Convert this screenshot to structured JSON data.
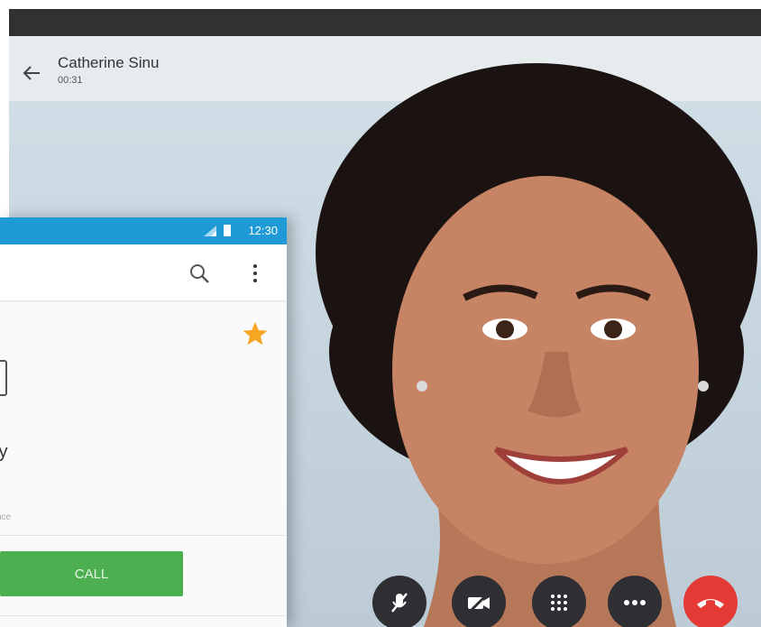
{
  "call": {
    "contact_name": "Catherine Sinu",
    "timer": "00:31",
    "controls": {
      "mute_icon": "mic-off-icon",
      "video_icon": "video-off-icon",
      "keypad_icon": "dialpad-icon",
      "more_icon": "more-horizontal-icon",
      "end_icon": "end-call-icon"
    },
    "colors": {
      "end_call": "#e53935",
      "control_bg": "#2f2f33"
    }
  },
  "phone": {
    "status_time": "12:30",
    "contact_name_partial": "ly",
    "contact_sub_partial": "nce",
    "call_label": "CALL",
    "colors": {
      "status_bar": "#1e9ad6",
      "call_button": "#4caf50",
      "star": "#f6a623"
    }
  }
}
